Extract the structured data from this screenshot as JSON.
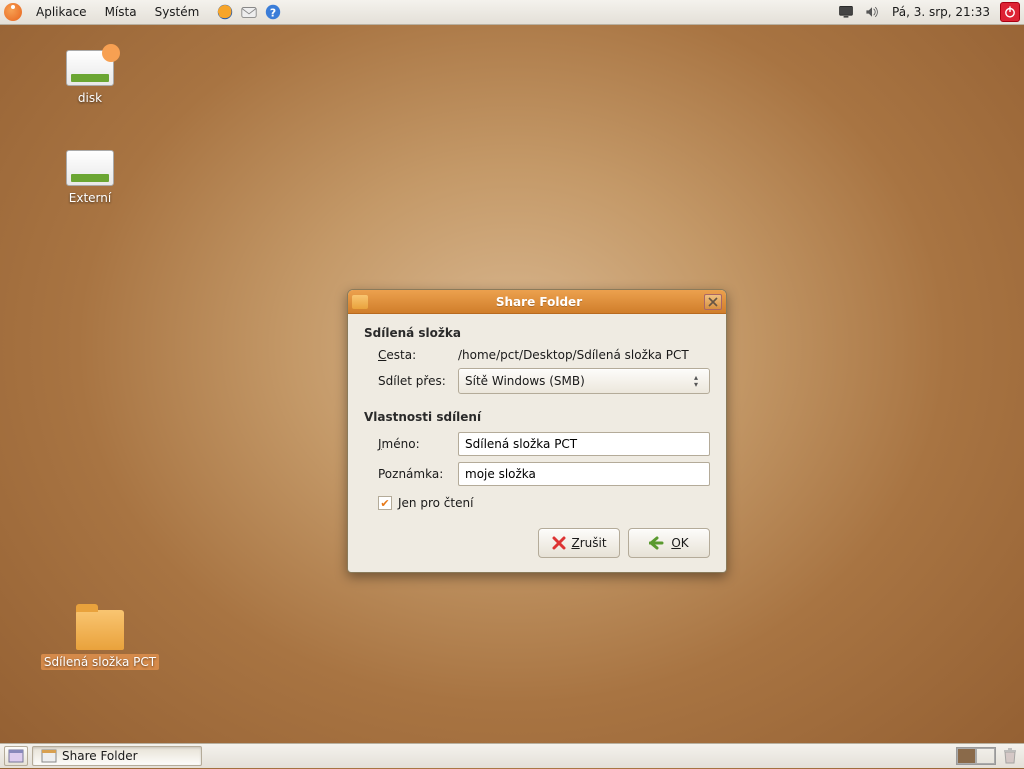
{
  "panel": {
    "menus": [
      "Aplikace",
      "Místa",
      "Systém"
    ],
    "clock": "Pá,  3. srp, 21:33"
  },
  "desktop": {
    "icons": [
      {
        "label": "disk",
        "type": "drive"
      },
      {
        "label": "Externí",
        "type": "drive"
      },
      {
        "label": "Sdílená složka PCT",
        "type": "folder"
      }
    ]
  },
  "dialog": {
    "title": "Share Folder",
    "section1": "Sdílená složka",
    "path_label": "Cesta:",
    "path_value": "/home/pct/Desktop/Sdílená složka PCT",
    "share_via_label": "Sdílet přes:",
    "share_via_value": "Sítě Windows (SMB)",
    "section2": "Vlastnosti sdílení",
    "name_label": "Jméno:",
    "name_value": "Sdílená složka PCT",
    "comment_label": "Poznámka:",
    "comment_value": "moje složka",
    "readonly_label": "Jen pro čtení",
    "readonly_checked": true,
    "cancel": "Zrušit",
    "ok": "OK"
  },
  "taskbar": {
    "item": "Share Folder"
  }
}
